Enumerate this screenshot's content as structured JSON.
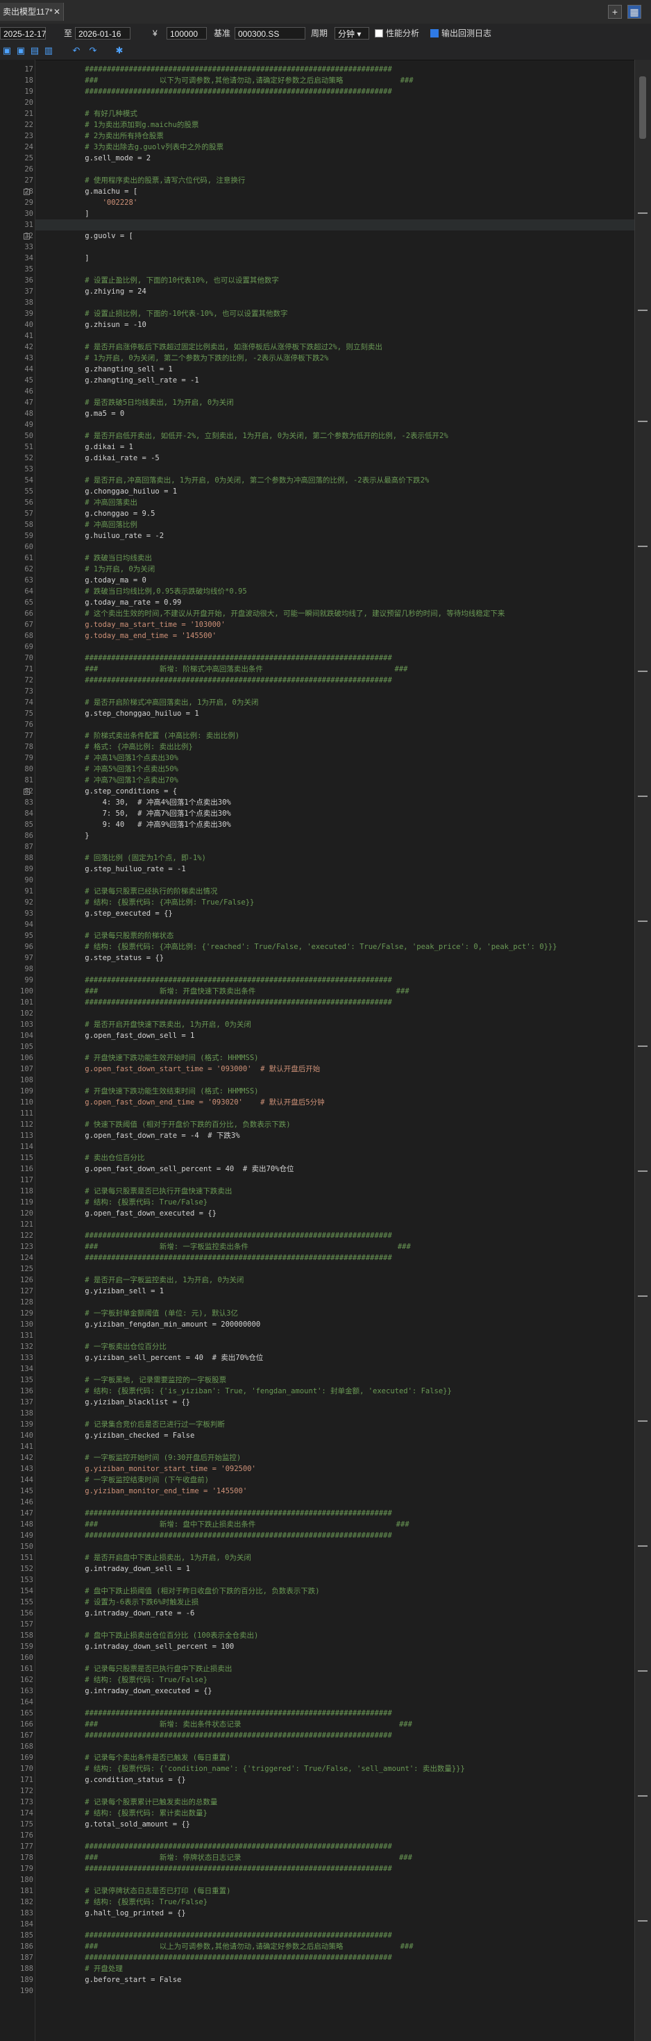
{
  "tab": {
    "title": "卖出模型117*",
    "close": "✕"
  },
  "window": {
    "plus": "+",
    "grid": "▦"
  },
  "toolbar": {
    "start_date": "2025-12-17",
    "to": "至",
    "end_date": "2026-01-16",
    "currency": "¥",
    "capital": "100000",
    "benchmark_label": "基准",
    "benchmark": "000300.SS",
    "period_label": "周期",
    "period": "分钟",
    "perf_label": "性能分析",
    "perf_checked": false,
    "log_label": "输出回测日志",
    "log_checked": true
  },
  "icons": [
    {
      "name": "save-icon",
      "glyph": "▣"
    },
    {
      "name": "save-as-icon",
      "glyph": "▣"
    },
    {
      "name": "open-icon",
      "glyph": "▤"
    },
    {
      "name": "export-icon",
      "glyph": "▥"
    },
    {
      "name": "undo-icon",
      "glyph": "↶"
    },
    {
      "name": "redo-icon",
      "glyph": "↷"
    },
    {
      "name": "settings-icon",
      "glyph": "✱"
    }
  ],
  "lines": [
    {
      "n": 17,
      "t": "    ######################################################################",
      "k": "comment"
    },
    {
      "n": 18,
      "t": "    ###              以下为可调参数,其他请勿动,请确定好参数之后启动策略             ###",
      "k": "comment"
    },
    {
      "n": 19,
      "t": "    ######################################################################",
      "k": "comment"
    },
    {
      "n": 20,
      "t": "",
      "k": "blank"
    },
    {
      "n": 21,
      "t": "    # 有好几种模式",
      "k": "comment"
    },
    {
      "n": 22,
      "t": "    # 1为卖出添加到g.maichu的股票",
      "k": "comment"
    },
    {
      "n": 23,
      "t": "    # 2为卖出所有持仓股票",
      "k": "comment"
    },
    {
      "n": 24,
      "t": "    # 3为卖出除去g.guolv列表中之外的股票",
      "k": "comment"
    },
    {
      "n": 25,
      "t": "    g.sell_mode = 2",
      "k": "code"
    },
    {
      "n": 26,
      "t": "",
      "k": "blank"
    },
    {
      "n": 27,
      "t": "    # 使用程序卖出的股票,请写六位代码, 注意换行",
      "k": "comment"
    },
    {
      "n": 28,
      "t": "    g.maichu = [",
      "k": "code",
      "fold": true
    },
    {
      "n": 29,
      "t": "        '002228'",
      "k": "string"
    },
    {
      "n": 30,
      "t": "    ]",
      "k": "code"
    },
    {
      "n": 31,
      "t": "",
      "k": "blank",
      "hl": true
    },
    {
      "n": 32,
      "t": "    g.guolv = [",
      "k": "code",
      "fold": true
    },
    {
      "n": 33,
      "t": "",
      "k": "blank"
    },
    {
      "n": 34,
      "t": "    ]",
      "k": "code"
    },
    {
      "n": 35,
      "t": "",
      "k": "blank"
    },
    {
      "n": 36,
      "t": "    # 设置止盈比例, 下面的10代表10%, 也可以设置其他数字",
      "k": "comment"
    },
    {
      "n": 37,
      "t": "    g.zhiying = 24",
      "k": "code"
    },
    {
      "n": 38,
      "t": "",
      "k": "blank"
    },
    {
      "n": 39,
      "t": "    # 设置止损比例, 下面的-10代表-10%, 也可以设置其他数字",
      "k": "comment"
    },
    {
      "n": 40,
      "t": "    g.zhisun = -10",
      "k": "code"
    },
    {
      "n": 41,
      "t": "",
      "k": "blank"
    },
    {
      "n": 42,
      "t": "    # 是否开启涨停板后下跌超过固定比例卖出, 如涨停板后从涨停板下跌超过2%, 则立刻卖出",
      "k": "comment"
    },
    {
      "n": 43,
      "t": "    # 1为开启, 0为关闭, 第二个参数为下跌的比例, -2表示从涨停板下跌2%",
      "k": "comment"
    },
    {
      "n": 44,
      "t": "    g.zhangting_sell = 1",
      "k": "code"
    },
    {
      "n": 45,
      "t": "    g.zhangting_sell_rate = -1",
      "k": "code"
    },
    {
      "n": 46,
      "t": "",
      "k": "blank"
    },
    {
      "n": 47,
      "t": "    # 是否跌破5日均线卖出, 1为开启, 0为关闭",
      "k": "comment"
    },
    {
      "n": 48,
      "t": "    g.ma5 = 0",
      "k": "code"
    },
    {
      "n": 49,
      "t": "",
      "k": "blank"
    },
    {
      "n": 50,
      "t": "    # 是否开启低开卖出, 如低开-2%, 立刻卖出, 1为开启, 0为关闭, 第二个参数为低开的比例, -2表示低开2%",
      "k": "comment"
    },
    {
      "n": 51,
      "t": "    g.dikai = 1",
      "k": "code"
    },
    {
      "n": 52,
      "t": "    g.dikai_rate = -5",
      "k": "code"
    },
    {
      "n": 53,
      "t": "",
      "k": "blank"
    },
    {
      "n": 54,
      "t": "    # 是否开启,冲高回落卖出, 1为开启, 0为关闭, 第二个参数为冲高回落的比例, -2表示从最高价下跌2%",
      "k": "comment"
    },
    {
      "n": 55,
      "t": "    g.chonggao_huiluo = 1",
      "k": "code"
    },
    {
      "n": 56,
      "t": "    # 冲高回落卖出",
      "k": "comment"
    },
    {
      "n": 57,
      "t": "    g.chonggao = 9.5",
      "k": "code"
    },
    {
      "n": 58,
      "t": "    # 冲高回落比例",
      "k": "comment"
    },
    {
      "n": 59,
      "t": "    g.huiluo_rate = -2",
      "k": "code"
    },
    {
      "n": 60,
      "t": "",
      "k": "blank"
    },
    {
      "n": 61,
      "t": "    # 跌破当日均线卖出",
      "k": "comment"
    },
    {
      "n": 62,
      "t": "    # 1为开启, 0为关闭",
      "k": "comment"
    },
    {
      "n": 63,
      "t": "    g.today_ma = 0",
      "k": "code"
    },
    {
      "n": 64,
      "t": "    # 跌破当日均线比例,0.95表示跌破均线价*0.95",
      "k": "comment"
    },
    {
      "n": 65,
      "t": "    g.today_ma_rate = 0.99",
      "k": "code"
    },
    {
      "n": 66,
      "t": "    # 这个卖出生效的时间,不建议从开盘开始, 开盘波动很大, 可能一瞬间就跌破均线了, 建议预留几秒的时间, 等待均线稳定下来",
      "k": "comment"
    },
    {
      "n": 67,
      "t": "    g.today_ma_start_time = '103000'",
      "k": "string"
    },
    {
      "n": 68,
      "t": "    g.today_ma_end_time = '145500'",
      "k": "string"
    },
    {
      "n": 69,
      "t": "",
      "k": "blank"
    },
    {
      "n": 70,
      "t": "    ######################################################################",
      "k": "comment"
    },
    {
      "n": 71,
      "t": "    ###              新增: 阶梯式冲高回落卖出条件                              ###",
      "k": "comment"
    },
    {
      "n": 72,
      "t": "    ######################################################################",
      "k": "comment"
    },
    {
      "n": 73,
      "t": "",
      "k": "blank"
    },
    {
      "n": 74,
      "t": "    # 是否开启阶梯式冲高回落卖出, 1为开启, 0为关闭",
      "k": "comment"
    },
    {
      "n": 75,
      "t": "    g.step_chonggao_huiluo = 1",
      "k": "code"
    },
    {
      "n": 76,
      "t": "",
      "k": "blank"
    },
    {
      "n": 77,
      "t": "    # 阶梯式卖出条件配置 (冲高比例: 卖出比例)",
      "k": "comment"
    },
    {
      "n": 78,
      "t": "    # 格式: {冲高比例: 卖出比例}",
      "k": "comment"
    },
    {
      "n": 79,
      "t": "    # 冲高1%回落1个点卖出30%",
      "k": "comment"
    },
    {
      "n": 80,
      "t": "    # 冲高5%回落1个点卖出50%",
      "k": "comment"
    },
    {
      "n": 81,
      "t": "    # 冲高7%回落1个点卖出70%",
      "k": "comment"
    },
    {
      "n": 82,
      "t": "    g.step_conditions = {",
      "k": "code",
      "fold": true
    },
    {
      "n": 83,
      "t": "        4: 30,  # 冲高4%回落1个点卖出30%",
      "k": "code"
    },
    {
      "n": 84,
      "t": "        7: 50,  # 冲高7%回落1个点卖出30%",
      "k": "code"
    },
    {
      "n": 85,
      "t": "        9: 40   # 冲高9%回落1个点卖出30%",
      "k": "code"
    },
    {
      "n": 86,
      "t": "    }",
      "k": "code"
    },
    {
      "n": 87,
      "t": "",
      "k": "blank"
    },
    {
      "n": 88,
      "t": "    # 回落比例 (固定为1个点, 即-1%)",
      "k": "comment"
    },
    {
      "n": 89,
      "t": "    g.step_huiluo_rate = -1",
      "k": "code"
    },
    {
      "n": 90,
      "t": "",
      "k": "blank"
    },
    {
      "n": 91,
      "t": "    # 记录每只股票已经执行的阶梯卖出情况",
      "k": "comment"
    },
    {
      "n": 92,
      "t": "    # 结构: {股票代码: {冲高比例: True/False}}",
      "k": "comment"
    },
    {
      "n": 93,
      "t": "    g.step_executed = {}",
      "k": "code"
    },
    {
      "n": 94,
      "t": "",
      "k": "blank"
    },
    {
      "n": 95,
      "t": "    # 记录每只股票的阶梯状态",
      "k": "comment"
    },
    {
      "n": 96,
      "t": "    # 结构: {股票代码: {冲高比例: {'reached': True/False, 'executed': True/False, 'peak_price': 0, 'peak_pct': 0}}}",
      "k": "comment"
    },
    {
      "n": 97,
      "t": "    g.step_status = {}",
      "k": "code"
    },
    {
      "n": 98,
      "t": "",
      "k": "blank"
    },
    {
      "n": 99,
      "t": "    ######################################################################",
      "k": "comment"
    },
    {
      "n": 100,
      "t": "    ###              新增: 开盘快速下跌卖出条件                                ###",
      "k": "comment"
    },
    {
      "n": 101,
      "t": "    ######################################################################",
      "k": "comment"
    },
    {
      "n": 102,
      "t": "",
      "k": "blank"
    },
    {
      "n": 103,
      "t": "    # 是否开启开盘快速下跌卖出, 1为开启, 0为关闭",
      "k": "comment"
    },
    {
      "n": 104,
      "t": "    g.open_fast_down_sell = 1",
      "k": "code"
    },
    {
      "n": 105,
      "t": "",
      "k": "blank"
    },
    {
      "n": 106,
      "t": "    # 开盘快速下跌功能生效开始时间 (格式: HHMMSS)",
      "k": "comment"
    },
    {
      "n": 107,
      "t": "    g.open_fast_down_start_time = '093000'  # 默认开盘后开始",
      "k": "string"
    },
    {
      "n": 108,
      "t": "",
      "k": "blank"
    },
    {
      "n": 109,
      "t": "    # 开盘快速下跌功能生效结束时间 (格式: HHMMSS)",
      "k": "comment"
    },
    {
      "n": 110,
      "t": "    g.open_fast_down_end_time = '093020'    # 默认开盘后5分钟",
      "k": "string"
    },
    {
      "n": 111,
      "t": "",
      "k": "blank"
    },
    {
      "n": 112,
      "t": "    # 快速下跌阈值 (相对于开盘价下跌的百分比, 负数表示下跌)",
      "k": "comment"
    },
    {
      "n": 113,
      "t": "    g.open_fast_down_rate = -4  # 下跌3%",
      "k": "code"
    },
    {
      "n": 114,
      "t": "",
      "k": "blank"
    },
    {
      "n": 115,
      "t": "    # 卖出仓位百分比",
      "k": "comment"
    },
    {
      "n": 116,
      "t": "    g.open_fast_down_sell_percent = 40  # 卖出70%仓位",
      "k": "code"
    },
    {
      "n": 117,
      "t": "",
      "k": "blank"
    },
    {
      "n": 118,
      "t": "    # 记录每只股票是否已执行开盘快速下跌卖出",
      "k": "comment"
    },
    {
      "n": 119,
      "t": "    # 结构: {股票代码: True/False}",
      "k": "comment"
    },
    {
      "n": 120,
      "t": "    g.open_fast_down_executed = {}",
      "k": "code"
    },
    {
      "n": 121,
      "t": "",
      "k": "blank"
    },
    {
      "n": 122,
      "t": "    ######################################################################",
      "k": "comment"
    },
    {
      "n": 123,
      "t": "    ###              新增: 一字板监控卖出条件                                  ###",
      "k": "comment"
    },
    {
      "n": 124,
      "t": "    ######################################################################",
      "k": "comment"
    },
    {
      "n": 125,
      "t": "",
      "k": "blank"
    },
    {
      "n": 126,
      "t": "    # 是否开启一字板监控卖出, 1为开启, 0为关闭",
      "k": "comment"
    },
    {
      "n": 127,
      "t": "    g.yiziban_sell = 1",
      "k": "code"
    },
    {
      "n": 128,
      "t": "",
      "k": "blank"
    },
    {
      "n": 129,
      "t": "    # 一字板封单金额阈值 (单位: 元), 默认3亿",
      "k": "comment"
    },
    {
      "n": 130,
      "t": "    g.yiziban_fengdan_min_amount = 200000000",
      "k": "code"
    },
    {
      "n": 131,
      "t": "",
      "k": "blank"
    },
    {
      "n": 132,
      "t": "    # 一字板卖出仓位百分比",
      "k": "comment"
    },
    {
      "n": 133,
      "t": "    g.yiziban_sell_percent = 40  # 卖出70%仓位",
      "k": "code"
    },
    {
      "n": 134,
      "t": "",
      "k": "blank"
    },
    {
      "n": 135,
      "t": "    # 一字板黑地, 记录需要监控的一字板股票",
      "k": "comment"
    },
    {
      "n": 136,
      "t": "    # 结构: {股票代码: {'is_yiziban': True, 'fengdan_amount': 封单金额, 'executed': False}}",
      "k": "comment"
    },
    {
      "n": 137,
      "t": "    g.yiziban_blacklist = {}",
      "k": "code"
    },
    {
      "n": 138,
      "t": "",
      "k": "blank"
    },
    {
      "n": 139,
      "t": "    # 记录集合竞价后是否已进行过一字板判断",
      "k": "comment"
    },
    {
      "n": 140,
      "t": "    g.yiziban_checked = False",
      "k": "code"
    },
    {
      "n": 141,
      "t": "",
      "k": "blank"
    },
    {
      "n": 142,
      "t": "    # 一字板监控开始时间 (9:30开盘后开始监控)",
      "k": "comment"
    },
    {
      "n": 143,
      "t": "    g.yiziban_monitor_start_time = '092500'",
      "k": "string"
    },
    {
      "n": 144,
      "t": "    # 一字板监控结束时间 (下午收盘前)",
      "k": "comment"
    },
    {
      "n": 145,
      "t": "    g.yiziban_monitor_end_time = '145500'",
      "k": "string"
    },
    {
      "n": 146,
      "t": "",
      "k": "blank"
    },
    {
      "n": 147,
      "t": "    ######################################################################",
      "k": "comment"
    },
    {
      "n": 148,
      "t": "    ###              新增: 盘中下跌止损卖出条件                                ###",
      "k": "comment"
    },
    {
      "n": 149,
      "t": "    ######################################################################",
      "k": "comment"
    },
    {
      "n": 150,
      "t": "",
      "k": "blank"
    },
    {
      "n": 151,
      "t": "    # 是否开启盘中下跌止损卖出, 1为开启, 0为关闭",
      "k": "comment"
    },
    {
      "n": 152,
      "t": "    g.intraday_down_sell = 1",
      "k": "code"
    },
    {
      "n": 153,
      "t": "",
      "k": "blank"
    },
    {
      "n": 154,
      "t": "    # 盘中下跌止损阈值 (相对于昨日收盘价下跌的百分比, 负数表示下跌)",
      "k": "comment"
    },
    {
      "n": 155,
      "t": "    # 设置为-6表示下跌6%时触发止损",
      "k": "comment"
    },
    {
      "n": 156,
      "t": "    g.intraday_down_rate = -6",
      "k": "code"
    },
    {
      "n": 157,
      "t": "",
      "k": "blank"
    },
    {
      "n": 158,
      "t": "    # 盘中下跌止损卖出仓位百分比 (100表示全仓卖出)",
      "k": "comment"
    },
    {
      "n": 159,
      "t": "    g.intraday_down_sell_percent = 100",
      "k": "code"
    },
    {
      "n": 160,
      "t": "",
      "k": "blank"
    },
    {
      "n": 161,
      "t": "    # 记录每只股票是否已执行盘中下跌止损卖出",
      "k": "comment"
    },
    {
      "n": 162,
      "t": "    # 结构: {股票代码: True/False}",
      "k": "comment"
    },
    {
      "n": 163,
      "t": "    g.intraday_down_executed = {}",
      "k": "code"
    },
    {
      "n": 164,
      "t": "",
      "k": "blank"
    },
    {
      "n": 165,
      "t": "    ######################################################################",
      "k": "comment"
    },
    {
      "n": 166,
      "t": "    ###              新增: 卖出条件状态记录                                    ###",
      "k": "comment"
    },
    {
      "n": 167,
      "t": "    ######################################################################",
      "k": "comment"
    },
    {
      "n": 168,
      "t": "",
      "k": "blank"
    },
    {
      "n": 169,
      "t": "    # 记录每个卖出条件是否已触发 (每日重置)",
      "k": "comment"
    },
    {
      "n": 170,
      "t": "    # 结构: {股票代码: {'condition_name': {'triggered': True/False, 'sell_amount': 卖出数量}}}",
      "k": "comment"
    },
    {
      "n": 171,
      "t": "    g.condition_status = {}",
      "k": "code"
    },
    {
      "n": 172,
      "t": "",
      "k": "blank"
    },
    {
      "n": 173,
      "t": "    # 记录每个股票累计已触发卖出的总数量",
      "k": "comment"
    },
    {
      "n": 174,
      "t": "    # 结构: {股票代码: 累计卖出数量}",
      "k": "comment"
    },
    {
      "n": 175,
      "t": "    g.total_sold_amount = {}",
      "k": "code"
    },
    {
      "n": 176,
      "t": "",
      "k": "blank"
    },
    {
      "n": 177,
      "t": "    ######################################################################",
      "k": "comment"
    },
    {
      "n": 178,
      "t": "    ###              新增: 停牌状态日志记录                                    ###",
      "k": "comment"
    },
    {
      "n": 179,
      "t": "    ######################################################################",
      "k": "comment"
    },
    {
      "n": 180,
      "t": "",
      "k": "blank"
    },
    {
      "n": 181,
      "t": "    # 记录停牌状态日志是否已打印 (每日重置)",
      "k": "comment"
    },
    {
      "n": 182,
      "t": "    # 结构: {股票代码: True/False}",
      "k": "comment"
    },
    {
      "n": 183,
      "t": "    g.halt_log_printed = {}",
      "k": "code"
    },
    {
      "n": 184,
      "t": "",
      "k": "blank"
    },
    {
      "n": 185,
      "t": "    ######################################################################",
      "k": "comment"
    },
    {
      "n": 186,
      "t": "    ###              以上为可调参数,其他请勿动,请确定好参数之后启动策略             ###",
      "k": "comment"
    },
    {
      "n": 187,
      "t": "    ######################################################################",
      "k": "comment"
    },
    {
      "n": 188,
      "t": "    # 开盘处理",
      "k": "comment"
    },
    {
      "n": 189,
      "t": "    g.before_start = False",
      "k": "code"
    },
    {
      "n": 190,
      "t": "",
      "k": "blank"
    }
  ]
}
